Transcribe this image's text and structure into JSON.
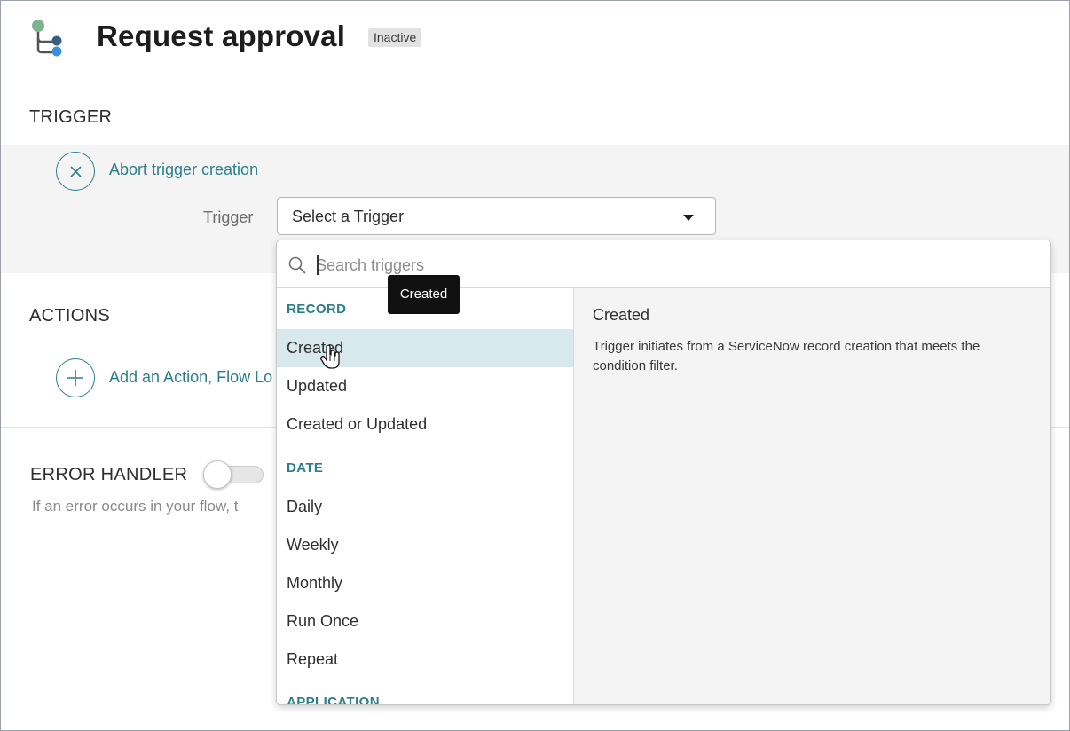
{
  "header": {
    "title": "Request approval",
    "status": "Inactive",
    "icon": "flow-branch-icon"
  },
  "trigger": {
    "section_label": "TRIGGER",
    "abort_label": "Abort trigger creation",
    "field_label": "Trigger",
    "select_value": "Select a Trigger"
  },
  "actions": {
    "section_label": "ACTIONS",
    "add_label": "Add an Action, Flow Lo"
  },
  "error_handler": {
    "label": "ERROR HANDLER",
    "enabled": false,
    "description": "If an error occurs in your flow, t"
  },
  "dropdown": {
    "search_placeholder": "Search triggers",
    "categories": [
      {
        "label": "RECORD",
        "options": [
          "Created",
          "Updated",
          "Created or Updated"
        ]
      },
      {
        "label": "DATE",
        "options": [
          "Daily",
          "Weekly",
          "Monthly",
          "Run Once",
          "Repeat"
        ]
      },
      {
        "label": "APPLICATION",
        "options": []
      }
    ],
    "selected_option": "Created",
    "detail": {
      "title": "Created",
      "description": "Trigger initiates from a ServiceNow record creation that meets the condition filter."
    }
  },
  "tooltip": {
    "text": "Created"
  },
  "colors": {
    "accent": "#2b7f8c",
    "selected_row": "#d8e9ee",
    "panel_bg": "#f4f4f4"
  }
}
